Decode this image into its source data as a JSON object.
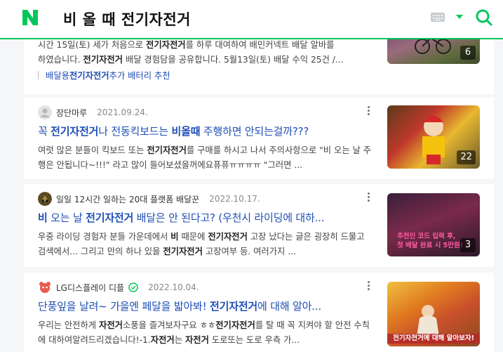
{
  "search": {
    "query": "비 올 때 전기자전거"
  },
  "colors": {
    "brand": "#03c75a",
    "link": "#1e4eb5"
  },
  "icons": [
    "naver-logo-icon",
    "keyboard-icon",
    "dropdown-arrow-icon",
    "search-icon",
    "more-icon",
    "verified-check-icon"
  ],
  "results": [
    {
      "desc_line1_a": "시간 15일(토) 세가 처음으로 ",
      "desc_line1_b": "전기자전거",
      "desc_line1_c": "를 하루 대여하여 배민커넥트 배달 알바를",
      "desc_line2_a": "하였습니다. ",
      "desc_line2_b": "전기자전거",
      "desc_line2_c": " 배달 경험담을 공유합니다. 5월13일(토) 배달 수익 25건 /...",
      "related_a": "배달용 ",
      "related_b": "전기자전거",
      "related_c": " 추가 배터리 추천",
      "thumb_count": "6"
    },
    {
      "author": "장단마루",
      "date": "2021.09.24.",
      "title_a": "꼭 ",
      "title_b": "전기자전거",
      "title_c": "나 전동킥보드는 ",
      "title_d": "비올때",
      "title_e": " 주행하면 안되는걸까???",
      "desc_a": "여럿 많은 분들이 킥보드 또는 ",
      "desc_b": "전기자전거",
      "desc_c": "를 구매를 하시고 나서 주의사항으로 \"비 오는 날 주행은 안됩니다~!!!\" 라고 많이 들어보셨을꺼에요퓨퓨ㅠㅠㅠㅠ \"그러면 ...",
      "thumb_count": "22"
    },
    {
      "author": "일일 12시간 일하는 20대 플랫폼 배달꾼",
      "date": "2022.10.17.",
      "title_a": "비",
      "title_b": " 오는 날 ",
      "title_c": "전기자전거",
      "title_d": " 배달은 안 된다고? (우천시 라이딩에 대하...",
      "desc_a": "우중 라이딩 경험자 분들 가운데에서 ",
      "desc_b": "비",
      "desc_c": " 때문에 ",
      "desc_d": "전기자전거",
      "desc_e": " 고장 났다는 글은 굉장히 드물고 검색에서... 그리고 만의 하나 있을 ",
      "desc_f": "전기자전거",
      "desc_g": " 고장여부 등. 여러가지 ...",
      "thumb_caption_1": "추천인 코드 입력 후,",
      "thumb_caption_2": "첫 배달 완료 시 5만원!",
      "thumb_count": "3"
    },
    {
      "author": "LG디스플레이 디플",
      "date": "2022.10.04.",
      "title_a": "단풍잎을 날려~ 가을엔 페달을 밟아봐! ",
      "title_b": "전기자전거",
      "title_c": "에 대해 알아...",
      "desc_a": "우리는 안전하게 ",
      "desc_b": "자전거",
      "desc_c": "소풍을 즐겨보자구요 ㅎㅎ",
      "desc_d": "전기자전거",
      "desc_e": "를 탈 때 꼭 지켜야 할 안전 수칙에 대하여알려드리겠습니다!-1.",
      "desc_f": "자전거",
      "desc_g": "는 ",
      "desc_h": "자전거",
      "desc_i": " 도로또는 도로 우측 가...",
      "thumb_caption": "전기자전거에 대해 알아보자!"
    }
  ]
}
